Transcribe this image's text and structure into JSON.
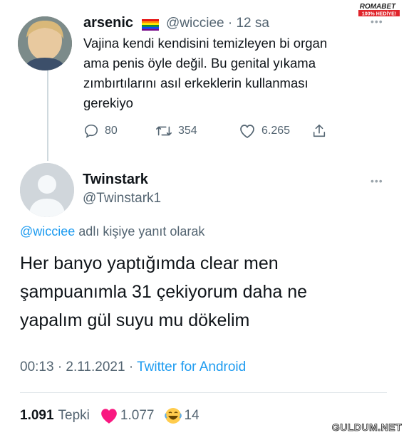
{
  "watermark_top": {
    "line1": "ROMABET",
    "line2": "100% HEDİYE!"
  },
  "watermark_bottom": "GULDUM.NET",
  "original_tweet": {
    "name": "arsenic",
    "handle": "@wicciee",
    "time": "· 12 sa",
    "text_lines": [
      "Vajina kendi kendisini temizleyen bi organ",
      "ama penis öyle değil. Bu genital yıkama",
      "zımbırtılarını asıl erkeklerin kullanması",
      "gerekiyo"
    ],
    "replies": "80",
    "retweets": "354",
    "likes": "6.265"
  },
  "reply_tweet": {
    "name": "Twinstark",
    "handle": "@Twinstark1",
    "reply_to_handle": "@wicciee",
    "reply_to_suffix": " adlı kişiye yanıt olarak",
    "text_lines": [
      "Her banyo yaptığımda clear men",
      "şampuanımla 31 çekiyorum daha ne",
      "yapalım gül suyu mu dökelim"
    ],
    "time": "00:13 · 2.11.2021 · ",
    "source": "Twitter for Android",
    "reactions_total": "1.091",
    "reactions_label": "Tepki",
    "heart_count": "1.077",
    "laugh_count": "14"
  },
  "colors": {
    "link": "#1d9bf0",
    "secondary": "#536471",
    "heart": "#f91880"
  }
}
